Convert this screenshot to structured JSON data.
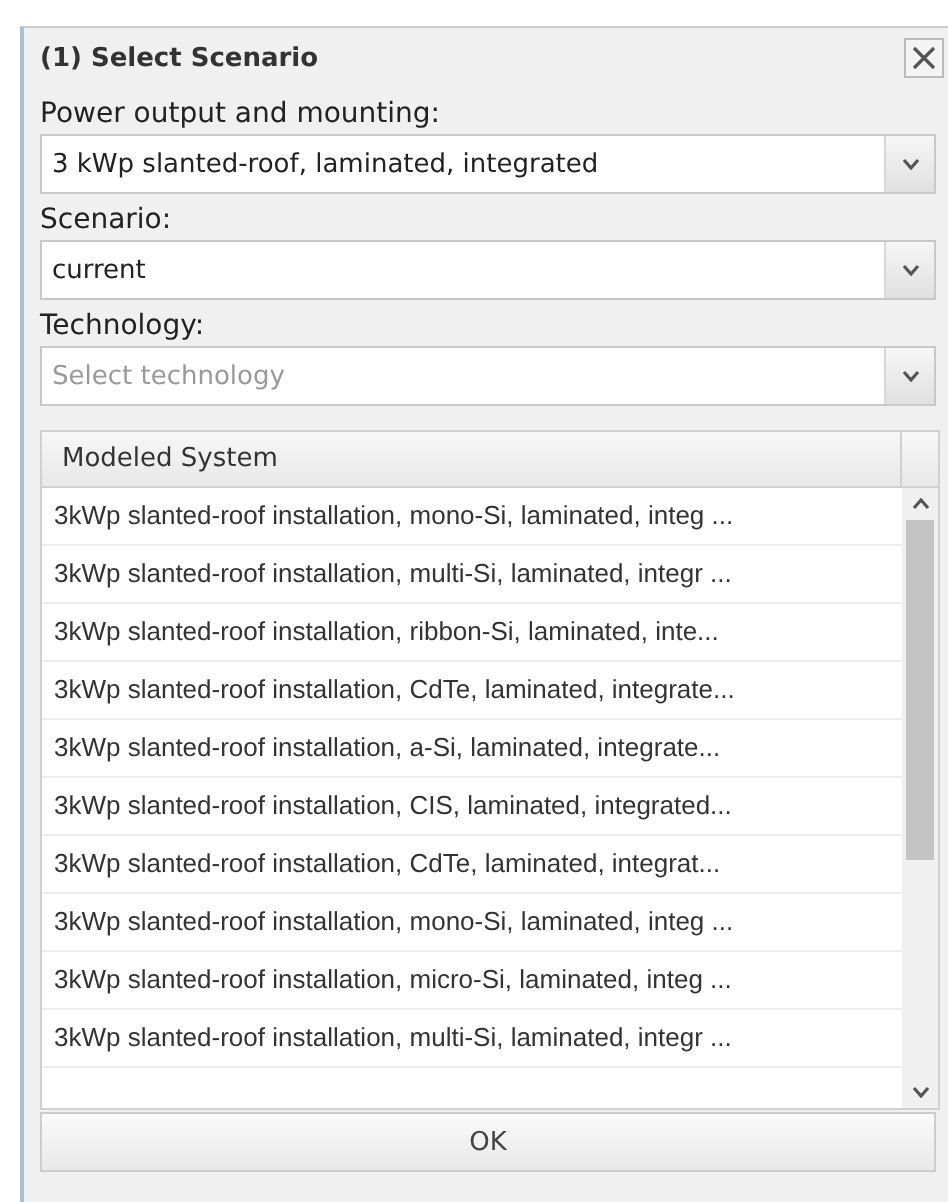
{
  "dialog": {
    "title": "(1) Select Scenario"
  },
  "fields": [
    {
      "label": "Power output and mounting:",
      "value": "3 kWp slanted-roof, laminated, integrated"
    },
    {
      "label": "Scenario:",
      "value": "current"
    },
    {
      "label": "Technology:",
      "placeholder": "Select technology"
    }
  ],
  "table": {
    "columns": [
      "Modeled System"
    ],
    "rows": [
      "3kWp slanted-roof installation, mono-Si, laminated, integ ...",
      "3kWp slanted-roof installation, multi-Si, laminated, integr ...",
      "3kWp slanted-roof installation, ribbon-Si, laminated, inte...",
      "3kWp slanted-roof installation, CdTe, laminated, integrate...",
      "3kWp slanted-roof installation, a-Si, laminated, integrate...",
      "3kWp slanted-roof installation, CIS, laminated, integrated...",
      "3kWp slanted-roof installation, CdTe, laminated, integrat...",
      "3kWp slanted-roof installation, mono-Si, laminated, integ ...",
      "3kWp slanted-roof installation, micro-Si, laminated, integ ...",
      "3kWp slanted-roof installation, multi-Si, laminated, integr ..."
    ]
  },
  "buttons": [
    "OK"
  ]
}
